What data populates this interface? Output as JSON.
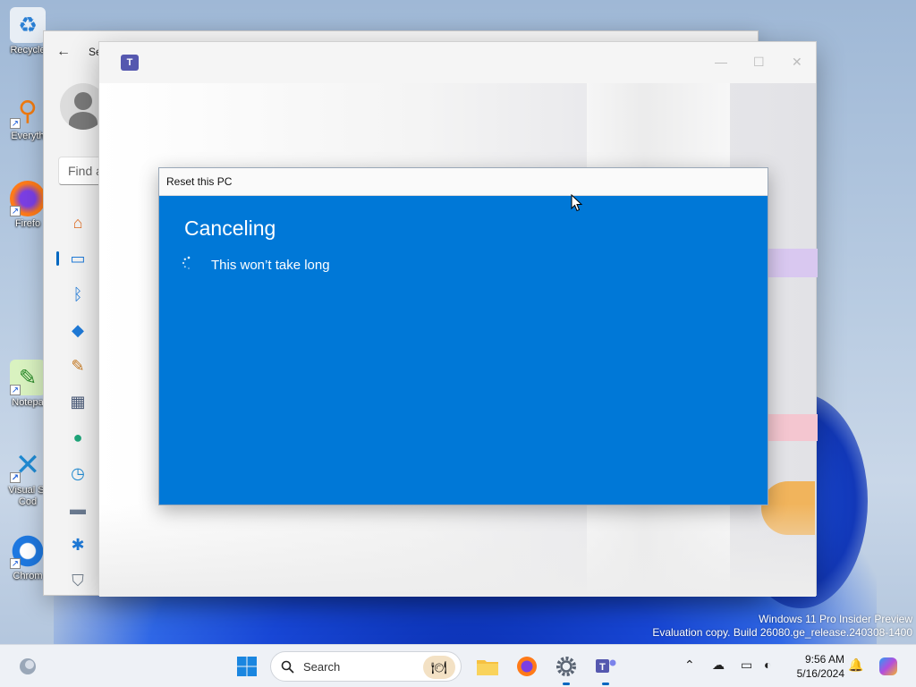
{
  "desktop": {
    "icons": [
      {
        "label": "Recycle",
        "icon": "recycle-bin-icon"
      },
      {
        "label": "Everyth",
        "icon": "everything-search-icon"
      },
      {
        "label": "Firefo",
        "icon": "firefox-icon"
      },
      {
        "label": "Notepa",
        "icon": "notepad-icon"
      },
      {
        "label": "Visual St Cod",
        "icon": "vscode-icon"
      },
      {
        "label": "Chrom",
        "icon": "chrome-icon"
      }
    ],
    "watermark": {
      "line1": "Windows 11 Pro Insider Preview",
      "line2": "Evaluation copy. Build 26080.ge_release.240308-1400"
    }
  },
  "settings_window": {
    "title": "Se",
    "search_placeholder": "Find a",
    "nav_icons": [
      "home-icon",
      "system-icon",
      "bluetooth-icon",
      "network-icon",
      "personalization-icon",
      "apps-icon",
      "accounts-icon",
      "time-language-icon",
      "gaming-icon",
      "accessibility-icon",
      "privacy-security-icon"
    ]
  },
  "teams_window": {
    "app_icon_text": "T"
  },
  "reset_dialog": {
    "title": "Reset this PC",
    "heading": "Canceling",
    "message": "This won’t take long",
    "color": "#0078d7"
  },
  "taskbar": {
    "search_placeholder": "Search",
    "time": "9:56 AM",
    "date": "5/16/2024"
  }
}
